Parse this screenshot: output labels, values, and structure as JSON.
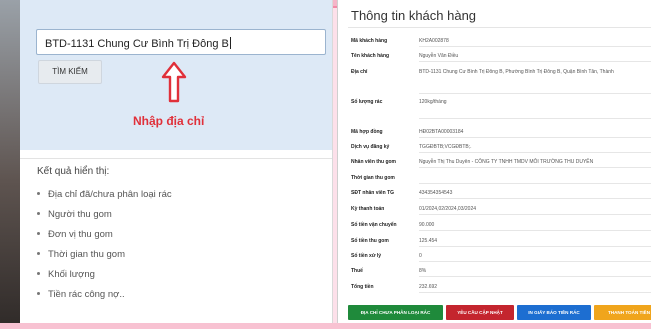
{
  "search": {
    "value": "BTD-1131 Chung Cư Bình Trị Đông B",
    "button_label": "TÌM KIẾM",
    "hint": "Nhập địa chỉ"
  },
  "results": {
    "title": "Kết quả hiển thị:",
    "items": [
      "Địa chỉ đã/chưa phân loại rác",
      "Người thu gom",
      "Đơn vị thu gom",
      "Thời gian thu gom",
      "Khối lượng",
      "Tiền rác công nợ.."
    ]
  },
  "customer_info": {
    "title": "Thông tin khách hàng",
    "fields": [
      {
        "label": "Mã khách hàng",
        "value": "KH2A002878"
      },
      {
        "label": "Tên khách hàng",
        "value": "Nguyễn Văn Điều"
      },
      {
        "label": "Địa chỉ",
        "value": "BTD-1131 Chung Cư Bình Trị Đông B, Phường Bình Trị Đông B, Quận Bình Tân, Thành"
      },
      {
        "label": "Số lượng rác",
        "value": "120kg/tháng"
      },
      {
        "label": "Mã hợp đồng",
        "value": "HĐ02BTA00003184"
      },
      {
        "label": "Dịch vụ đăng ký",
        "value": "TGGĐBTB;VCGĐBTB;."
      },
      {
        "label": "Nhân viên thu gom",
        "value": "Nguyễn Thị Thu Duyên - CÔNG TY TNHH TMDV MÔI TRƯỜNG THU DUYÊN"
      },
      {
        "label": "Thời gian thu gom",
        "value": ""
      },
      {
        "label": "SĐT nhân viên TG",
        "value": "434354354543"
      },
      {
        "label": "Kỳ thanh toán",
        "value": "01/2024,02/2024,03/2024"
      },
      {
        "label": "Số tiền vận chuyển",
        "value": "90.000"
      },
      {
        "label": "Số tiền thu gom",
        "value": "125.454"
      },
      {
        "label": "Số tiền xử lý",
        "value": "0"
      },
      {
        "label": "Thuế",
        "value": "8%"
      },
      {
        "label": "Tổng tiền",
        "value": "232.692"
      }
    ]
  },
  "actions": {
    "classify": "ĐỊA CHỈ CHƯA PHÂN LOẠI RÁC",
    "update": "YÊU CẦU CẬP NHẬT",
    "print": "IN GIẤY BÁO TIỀN RÁC",
    "pay": "THANH TOÁN TIỀN"
  },
  "colors": {
    "hint_red": "#e0303a",
    "btn_green": "#1f8a3b",
    "btn_red": "#c4252e",
    "btn_blue": "#1d6ed1",
    "btn_orange": "#f0a51c"
  },
  "icons": {
    "hint_arrow": "arrow-up-icon",
    "bullet": "bullet-dot-icon"
  }
}
